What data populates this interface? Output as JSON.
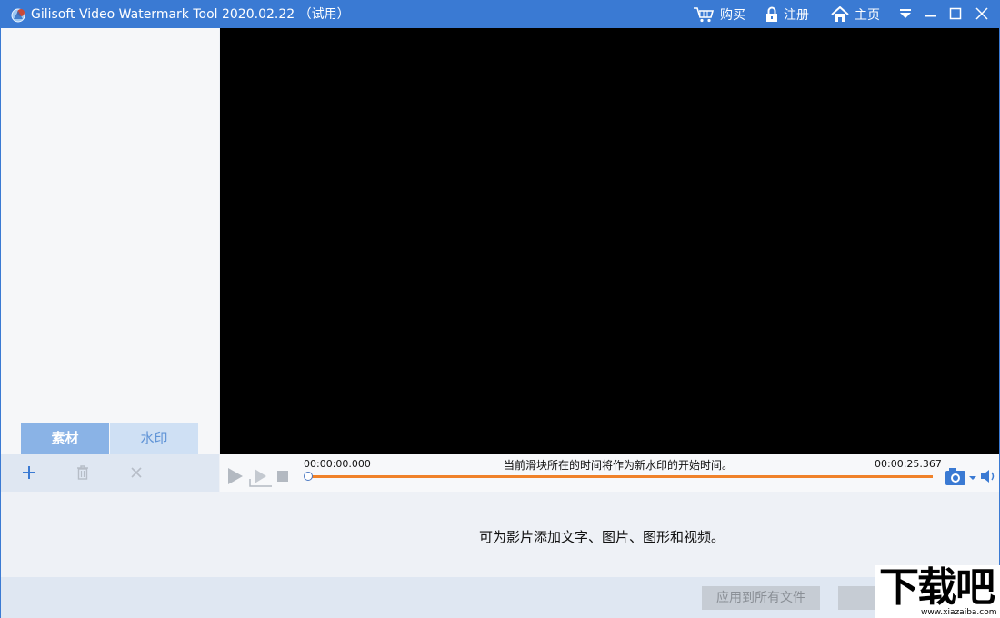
{
  "window": {
    "title": "Gilisoft Video Watermark Tool 2020.02.22 （试用）",
    "buy_label": "购买",
    "register_label": "注册",
    "home_label": "主页"
  },
  "colors": {
    "titlebar": "#3a7ad3",
    "progress": "#f0822a",
    "tab_active": "#8ab3e6",
    "tab_inactive": "#cfe0f4"
  },
  "left_panel": {
    "tabs": [
      {
        "label": "素材",
        "active": true
      },
      {
        "label": "水印",
        "active": false
      }
    ],
    "toolbar_icons": [
      "plus-icon",
      "trash-icon",
      "close-icon"
    ]
  },
  "player": {
    "current_time": "00:00:00.000",
    "total_time": "00:00:25.367",
    "hint": "当前滑块所在的时间将作为新水印的开始时间。",
    "position": 0
  },
  "bottom": {
    "message": "可为影片添加文字、图片、图形和视频。",
    "apply_all_label": "应用到所有文件"
  },
  "watermark": {
    "text": "下载吧",
    "url": "www.xiazaiba.com"
  }
}
